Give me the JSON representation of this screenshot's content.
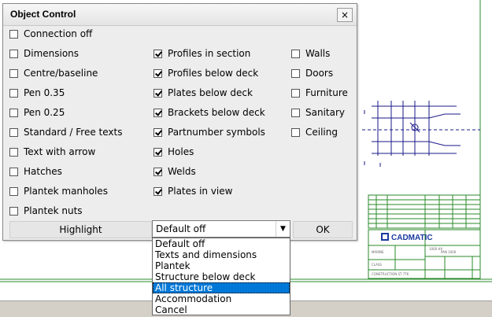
{
  "dialog": {
    "title": "Object Control",
    "close_label": "×"
  },
  "col1": [
    {
      "label": "Connection off",
      "checked": false
    },
    {
      "label": "Dimensions",
      "checked": false
    },
    {
      "label": "Centre/baseline",
      "checked": false
    },
    {
      "label": "Pen 0.35",
      "checked": false
    },
    {
      "label": "Pen 0.25",
      "checked": false
    },
    {
      "label": "Standard / Free texts",
      "checked": false
    },
    {
      "label": "Text with arrow",
      "checked": false
    },
    {
      "label": "Hatches",
      "checked": false
    },
    {
      "label": "Plantek manholes",
      "checked": false
    },
    {
      "label": "Plantek nuts",
      "checked": false
    }
  ],
  "col2": [
    {
      "label": "Profiles in section",
      "checked": true
    },
    {
      "label": "Profiles below deck",
      "checked": true
    },
    {
      "label": "Plates below deck",
      "checked": true
    },
    {
      "label": "Brackets below deck",
      "checked": true
    },
    {
      "label": "Partnumber symbols",
      "checked": true
    },
    {
      "label": "Holes",
      "checked": true
    },
    {
      "label": "Welds",
      "checked": true
    },
    {
      "label": "Plates in view",
      "checked": true
    }
  ],
  "col3": [
    {
      "label": "Walls",
      "checked": false
    },
    {
      "label": "Doors",
      "checked": false
    },
    {
      "label": "Furniture",
      "checked": false
    },
    {
      "label": "Sanitary",
      "checked": false
    },
    {
      "label": "Ceiling",
      "checked": false
    }
  ],
  "buttons": {
    "highlight": "Highlight",
    "ok": "OK"
  },
  "preset": {
    "selected": "Default off",
    "arrow": "▼",
    "options": [
      "Default off",
      "Texts and dimensions",
      "Plantek",
      "Structure below deck",
      "All structure",
      "Accommodation",
      "Cancel"
    ],
    "highlighted": "All structure"
  },
  "title_block": {
    "logo": "CADMATIC"
  }
}
